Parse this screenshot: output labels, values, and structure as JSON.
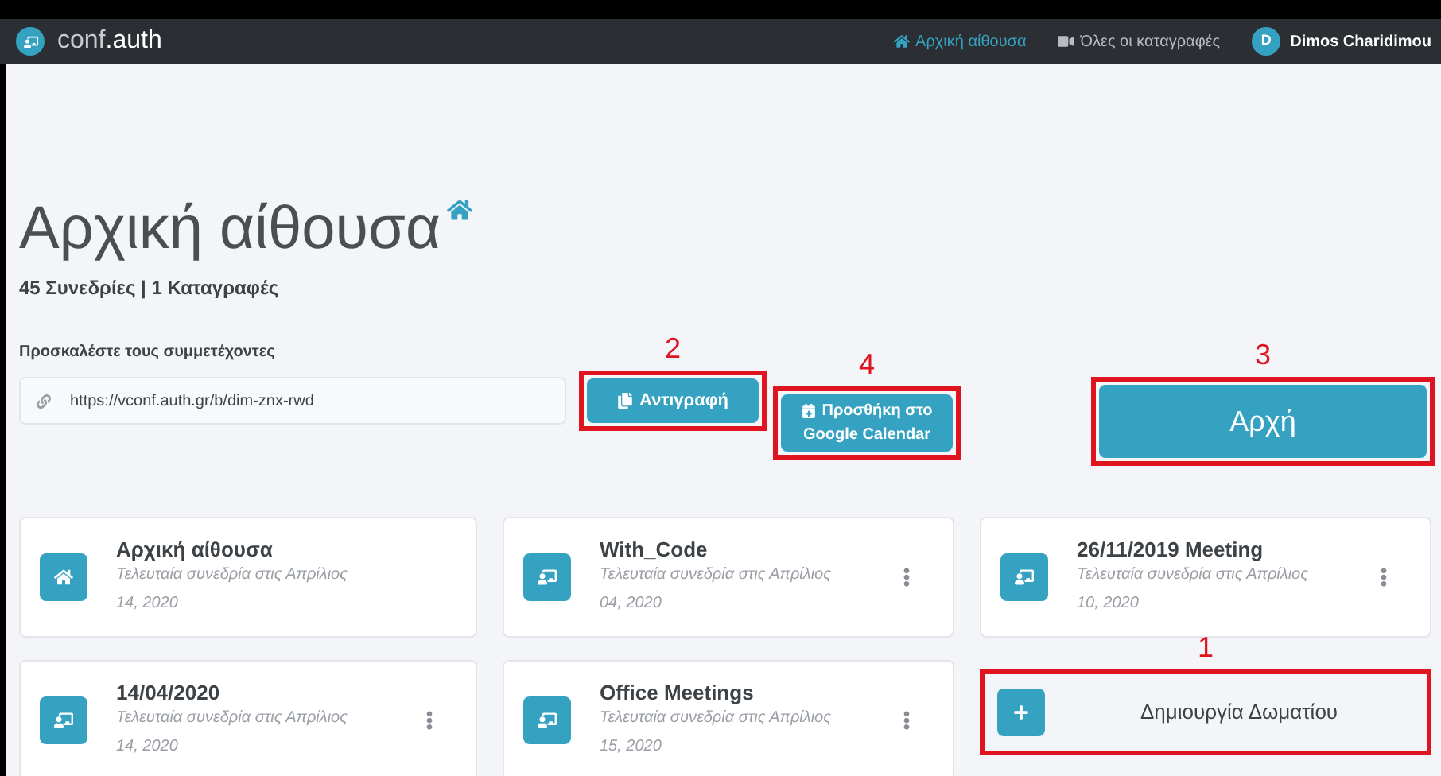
{
  "navbar": {
    "brand_light": "conf",
    "brand_bold": ".auth",
    "links": [
      {
        "label": "Αρχική αίθουσα",
        "selected": true
      },
      {
        "label": "Όλες οι καταγραφές",
        "selected": false
      }
    ],
    "user": {
      "initial": "D",
      "name": "Dimos Charidimou"
    }
  },
  "page": {
    "title": "Αρχική αίθουσα",
    "stats": "45 Συνεδρίες | 1 Καταγραφές",
    "invite_label": "Προσκαλέστε τους συμμετέχοντες",
    "invite_url": "https://vconf.auth.gr/b/dim-znx-rwd"
  },
  "actions": [
    {
      "kind": "copy",
      "label": "Αντιγραφή",
      "marker": "2"
    },
    {
      "kind": "calendar",
      "label_lines": [
        "Προσθήκη στο",
        "Google Calendar"
      ],
      "marker": "4"
    },
    {
      "kind": "start",
      "label": "Αρχή",
      "marker": "3"
    }
  ],
  "rooms": [
    {
      "kind": "home",
      "name": "Αρχική αίθουσα",
      "last_session": "Τελευταία συνεδρία στις Απρίλιος",
      "date": "14, 2020",
      "menu": false
    },
    {
      "kind": "room",
      "name": "With_Code",
      "last_session": "Τελευταία συνεδρία στις Απρίλιος",
      "date": "04, 2020",
      "menu": true
    },
    {
      "kind": "room",
      "name": "26/11/2019 Meeting",
      "last_session": "Τελευταία συνεδρία στις Απρίλιος",
      "date": "10, 2020",
      "menu": true
    },
    {
      "kind": "room",
      "name": "14/04/2020",
      "last_session": "Τελευταία συνεδρία στις Απρίλιος",
      "date": "14, 2020",
      "menu": true
    },
    {
      "kind": "room",
      "name": "Office Meetings",
      "last_session": "Τελευταία συνεδρία στις Απρίλιος",
      "date": "15, 2020",
      "menu": true
    },
    {
      "kind": "create",
      "name": "Δημιουργία Δωματίου",
      "marker": "1"
    }
  ]
}
